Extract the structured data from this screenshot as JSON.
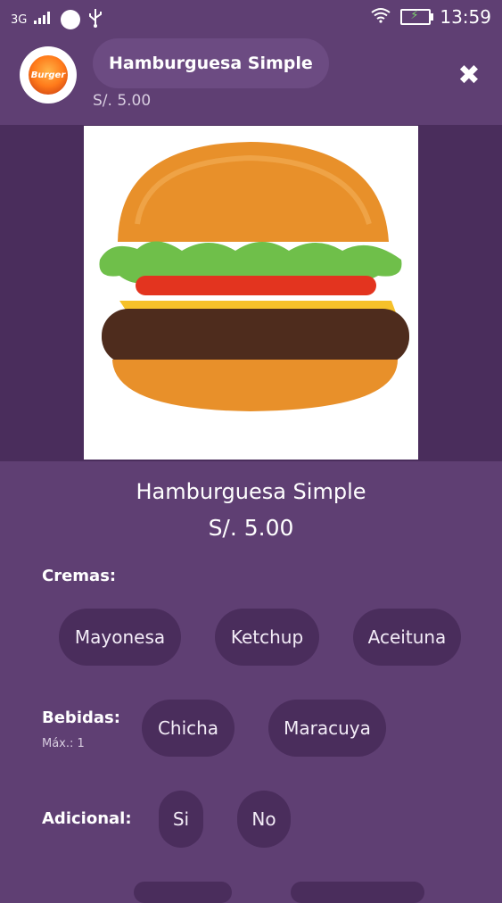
{
  "status_bar": {
    "network": "3G",
    "time": "13:59"
  },
  "header": {
    "logo_text": "Burger",
    "title": "Hamburguesa Simple",
    "price": "S/. 5.00",
    "close_icon": "close-icon"
  },
  "product": {
    "name": "Hamburguesa Simple",
    "price": "S/. 5.00"
  },
  "sections": {
    "cremas": {
      "label": "Cremas:",
      "options": [
        "Mayonesa",
        "Ketchup",
        "Aceituna"
      ]
    },
    "bebidas": {
      "label": "Bebidas:",
      "sub": "Máx.: 1",
      "options": [
        "Chicha",
        "Maracuya"
      ]
    },
    "adicional": {
      "label": "Adicional:",
      "options": [
        "Si",
        "No"
      ]
    }
  },
  "colors": {
    "background": "#5f3f73",
    "chip": "#4a2d5c",
    "image_band": "#4a2d5c"
  }
}
